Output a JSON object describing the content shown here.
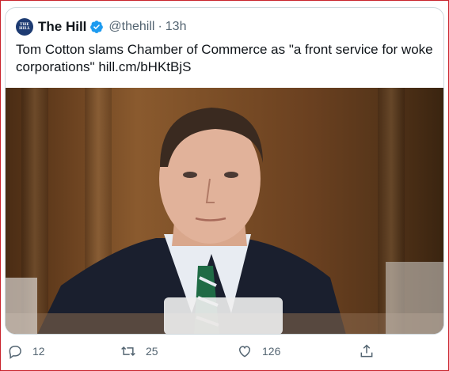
{
  "tweet": {
    "author": {
      "name": "The Hill",
      "handle": "@thehill",
      "time": "13h",
      "avatar_text": "THE HILL",
      "verified": true
    },
    "text": "Tom Cotton slams Chamber of Commerce as \"a front service for woke corporations\"",
    "link": "hill.cm/bHKtBjS",
    "image": {
      "alt": "Photo of a man in a dark suit with a green striped tie seated at a hearing"
    }
  },
  "actions": {
    "reply_count": "12",
    "retweet_count": "25",
    "like_count": "126"
  },
  "colors": {
    "accent": "#1d9bf0",
    "text": "#0f1419",
    "muted": "#536471",
    "border": "#cfd9de",
    "frame": "#c8232c"
  }
}
